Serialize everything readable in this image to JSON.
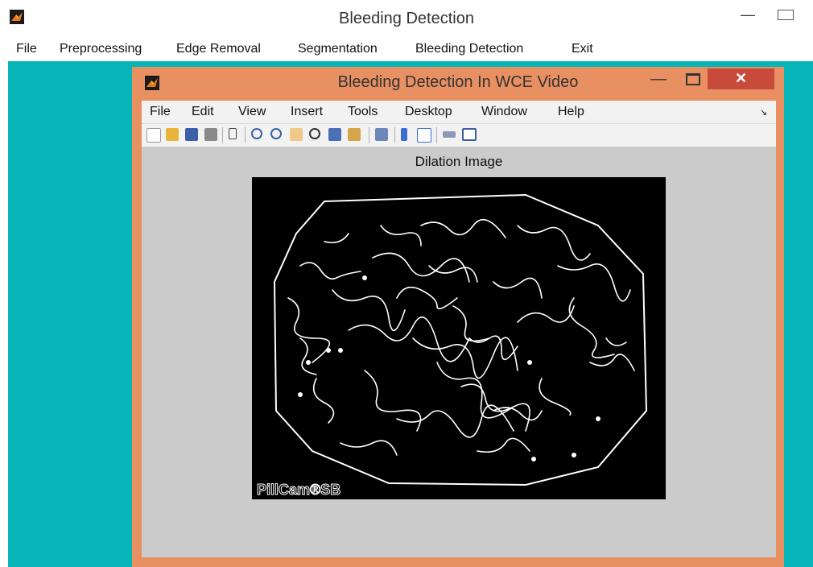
{
  "outer_window": {
    "title": "Bleeding Detection",
    "minimize": "—",
    "menu": [
      "File",
      "Preprocessing",
      "Edge Removal",
      "Segmentation",
      "Bleeding Detection",
      "Exit"
    ]
  },
  "figure_window": {
    "title": "Bleeding Detection In WCE Video",
    "minimize": "—",
    "close": "✕",
    "menu": [
      "File",
      "Edit",
      "View",
      "Insert",
      "Tools",
      "Desktop",
      "Window",
      "Help"
    ],
    "dock_arrow": "↘",
    "toolbar_icons": [
      "new-figure-icon",
      "open-file-icon",
      "save-icon",
      "print-icon",
      "pointer-icon",
      "zoom-in-icon",
      "zoom-out-icon",
      "pan-icon",
      "rotate-icon",
      "data-cursor-icon",
      "brush-icon",
      "link-icon",
      "colorbar-icon",
      "legend-icon",
      "hide-plot-tools-icon",
      "show-plot-tools-icon"
    ]
  },
  "axes": {
    "title": "Dilation Image",
    "watermark": "PillCam®SB"
  },
  "colors": {
    "desktop_teal": "#06b5b8",
    "frame_orange": "#e99063",
    "close_red": "#c84a3b",
    "canvas_gray": "#cbcbcb"
  }
}
